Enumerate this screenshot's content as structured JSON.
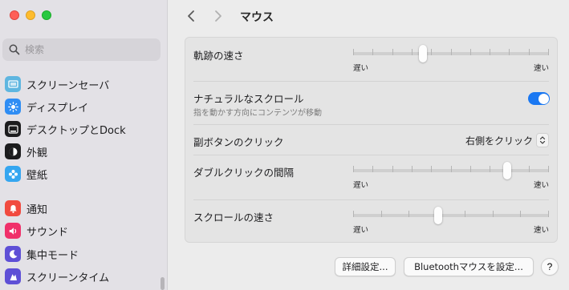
{
  "search": {
    "placeholder": "検索"
  },
  "sidebar": {
    "items": [
      {
        "label": "スクリーンセーバ",
        "icon": "screensaver-icon",
        "color": "#5fb6e0"
      },
      {
        "label": "ディスプレイ",
        "icon": "display-icon",
        "color": "#2f8df4"
      },
      {
        "label": "デスクトップとDock",
        "icon": "dock-icon",
        "color": "#1c1c1e"
      },
      {
        "label": "外観",
        "icon": "appearance-icon",
        "color": "#1c1c1e"
      },
      {
        "label": "壁紙",
        "icon": "wallpaper-icon",
        "color": "#35a6f0"
      },
      {
        "label": "通知",
        "icon": "notifications-icon",
        "color": "#f14a3f"
      },
      {
        "label": "サウンド",
        "icon": "sound-icon",
        "color": "#f0306a"
      },
      {
        "label": "集中モード",
        "icon": "focus-icon",
        "color": "#5e4fd6"
      },
      {
        "label": "スクリーンタイム",
        "icon": "screentime-icon",
        "color": "#5e4fd6"
      }
    ]
  },
  "header": {
    "title": "マウス"
  },
  "settings": {
    "tracking_speed": {
      "label": "軌跡の速さ",
      "min_label": "遅い",
      "max_label": "速い",
      "value": 0.35
    },
    "natural_scroll": {
      "label": "ナチュラルなスクロール",
      "sublabel": "指を動かす方向にコンテンツが移動",
      "enabled": true
    },
    "secondary_click": {
      "label": "副ボタンのクリック",
      "value": "右側をクリック"
    },
    "double_click": {
      "label": "ダブルクリックの間隔",
      "min_label": "遅い",
      "max_label": "速い",
      "value": 0.8
    },
    "scroll_speed": {
      "label": "スクロールの速さ",
      "min_label": "遅い",
      "max_label": "速い",
      "value": 0.43
    }
  },
  "footer": {
    "advanced_label": "詳細設定...",
    "bluetooth_label": "Bluetoothマウスを設定...",
    "help_label": "?"
  },
  "colors": {
    "accent": "#1a78f2"
  }
}
